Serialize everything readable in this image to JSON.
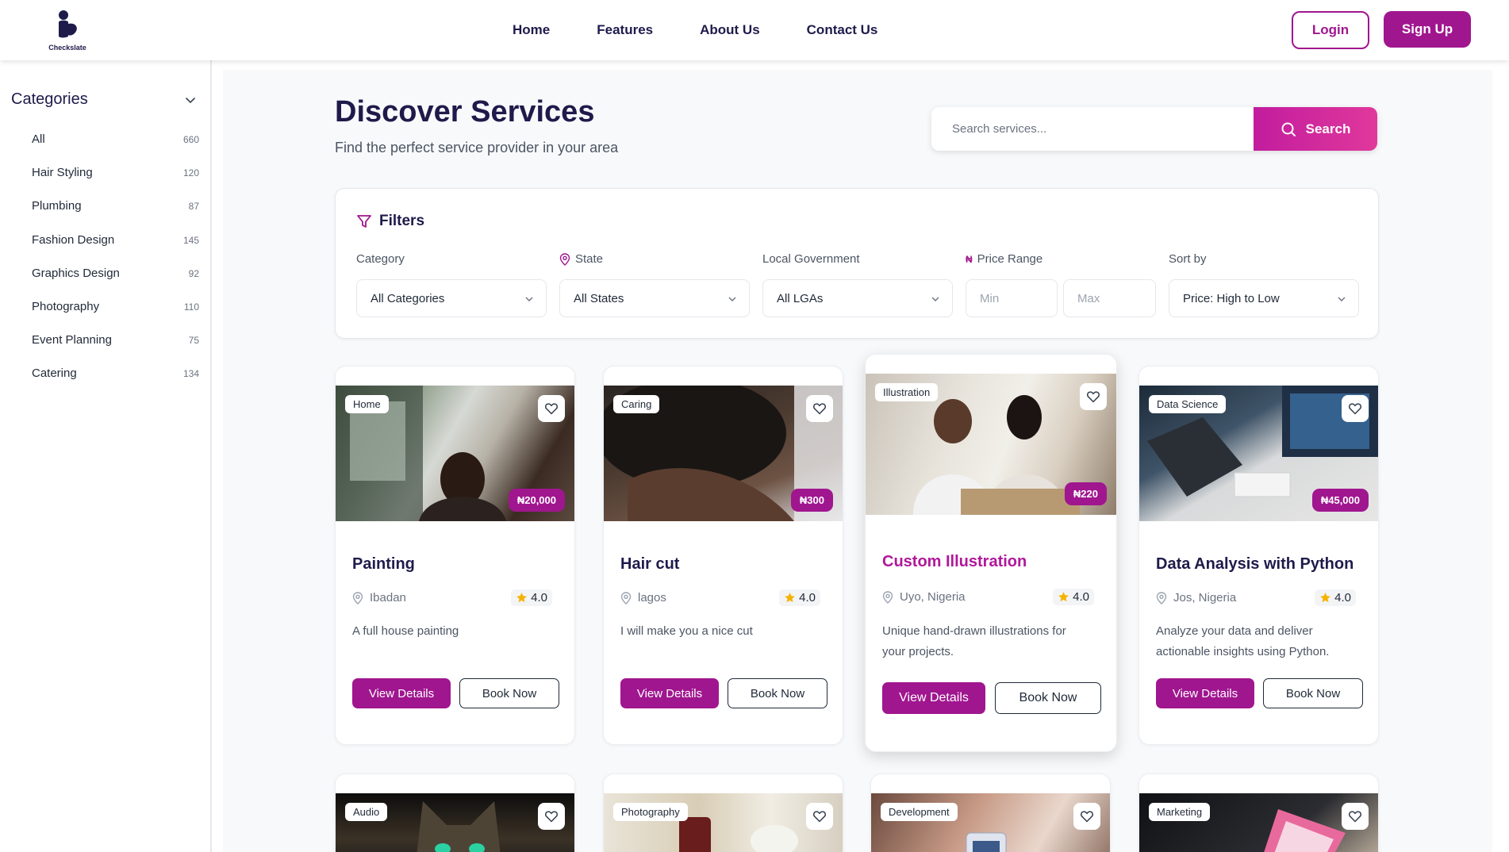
{
  "header": {
    "logo_text": "Checkslate",
    "nav": [
      "Home",
      "Features",
      "About Us",
      "Contact Us"
    ],
    "login_label": "Login",
    "signup_label": "Sign Up"
  },
  "sidebar": {
    "title": "Categories",
    "items": [
      {
        "label": "All",
        "count": "660"
      },
      {
        "label": "Hair Styling",
        "count": "120"
      },
      {
        "label": "Plumbing",
        "count": "87"
      },
      {
        "label": "Fashion Design",
        "count": "145"
      },
      {
        "label": "Graphics Design",
        "count": "92"
      },
      {
        "label": "Photography",
        "count": "110"
      },
      {
        "label": "Event Planning",
        "count": "75"
      },
      {
        "label": "Catering",
        "count": "134"
      }
    ]
  },
  "main": {
    "title": "Discover Services",
    "subtitle": "Find the perfect service provider in your area",
    "search": {
      "placeholder": "Search services...",
      "button_label": "Search"
    }
  },
  "filters": {
    "title": "Filters",
    "category": {
      "label": "Category",
      "value": "All Categories"
    },
    "state": {
      "label": "State",
      "value": "All States"
    },
    "lga": {
      "label": "Local Government",
      "value": "All LGAs"
    },
    "price": {
      "label": "Price Range",
      "min_placeholder": "Min",
      "max_placeholder": "Max"
    },
    "sort": {
      "label": "Sort by",
      "value": "Price: High to Low"
    }
  },
  "cards": [
    {
      "tag": "Home",
      "price": "₦20,000",
      "title": "Painting",
      "location": "Ibadan",
      "rating": "4.0",
      "description": [
        "A full house painting"
      ],
      "view_label": "View Details",
      "book_label": "Book Now"
    },
    {
      "tag": "Caring",
      "price": "₦300",
      "title": "Hair cut",
      "location": "lagos",
      "rating": "4.0",
      "description": [
        "I will make you a nice cut"
      ],
      "view_label": "View Details",
      "book_label": "Book Now"
    },
    {
      "tag": "Illustration",
      "price": "₦220",
      "title": "Custom Illustration",
      "location": "Uyo, Nigeria",
      "rating": "4.0",
      "description": [
        "Unique hand-drawn illustrations for",
        "your projects."
      ],
      "view_label": "View Details",
      "book_label": "Book Now"
    },
    {
      "tag": "Data Science",
      "price": "₦45,000",
      "title": "Data Analysis with Python",
      "location": "Jos, Nigeria",
      "rating": "4.0",
      "description": [
        "Analyze your data and deliver",
        "actionable insights using Python."
      ],
      "view_label": "View Details",
      "book_label": "Book Now"
    }
  ],
  "cards_row2": [
    {
      "tag": "Audio"
    },
    {
      "tag": "Photography"
    },
    {
      "tag": "Development"
    },
    {
      "tag": "Marketing"
    }
  ],
  "colors": {
    "brand": "#a0168f",
    "heading": "#1e1b4b",
    "star": "#f5b301"
  }
}
